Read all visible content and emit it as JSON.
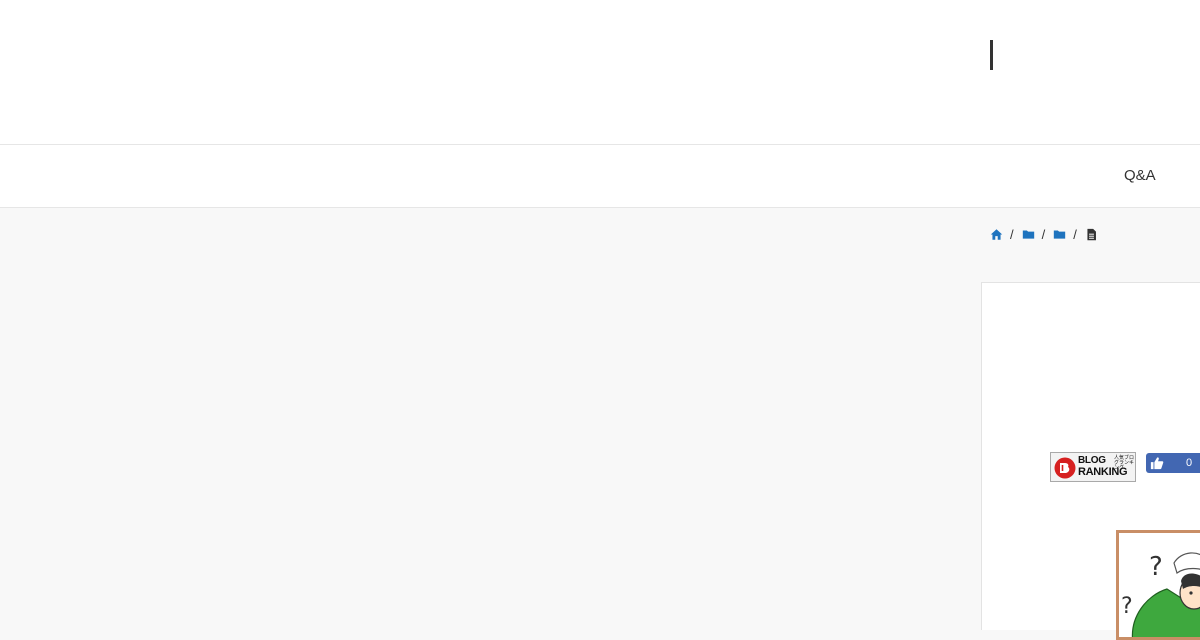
{
  "header": {
    "logo_name": "site-logo"
  },
  "nav": {
    "items": [
      {
        "label": "Q&A"
      }
    ]
  },
  "breadcrumb": {
    "separator": "/",
    "icons": [
      "home-icon",
      "folder-icon",
      "folder-icon",
      "file-icon"
    ]
  },
  "sidebar": {
    "blog_ranking": {
      "line1": "BLOG",
      "line2": "RANKING",
      "small": "人気ブログランキング"
    },
    "fb_like": {
      "count": "0"
    }
  },
  "colors": {
    "accent": "#1e73be",
    "background": "#f8f8f8",
    "fb_blue": "#4267b2",
    "cartoon_frame": "#c98e66",
    "cartoon_green": "#3ea83e"
  }
}
